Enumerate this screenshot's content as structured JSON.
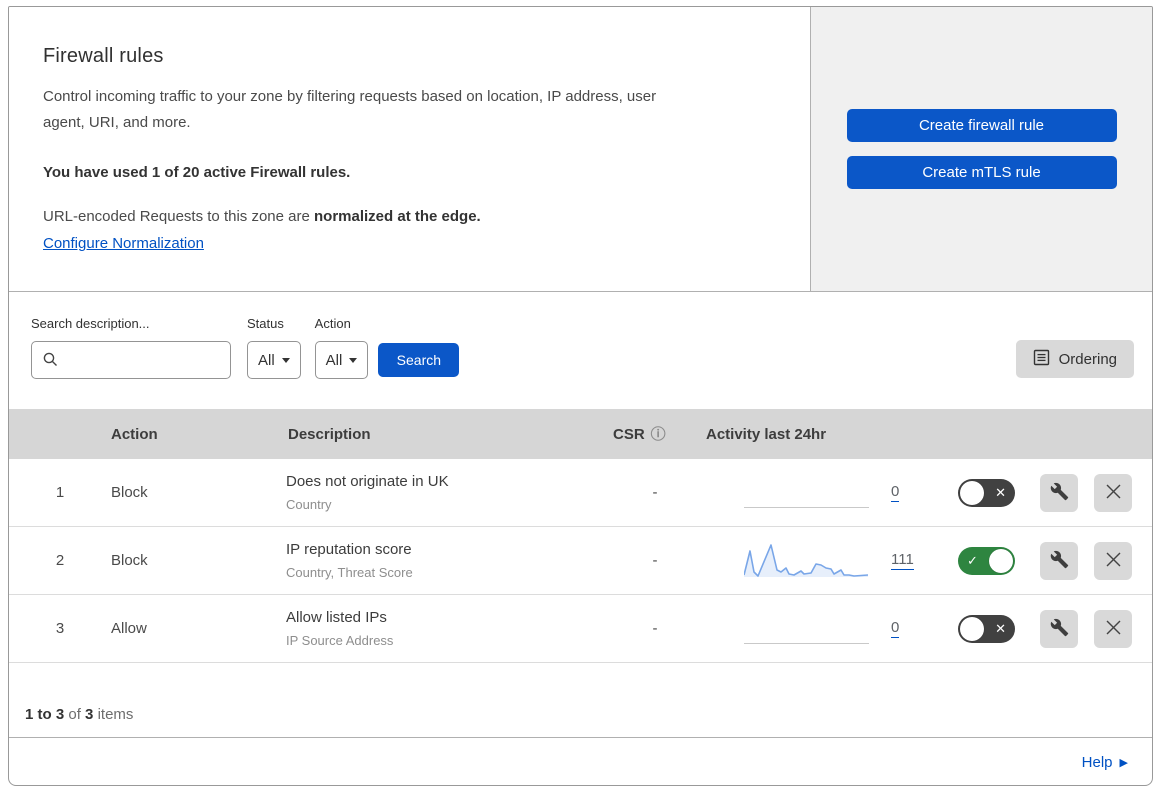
{
  "header": {
    "title": "Firewall rules",
    "description": "Control incoming traffic to your zone by filtering requests based on location, IP address, user agent, URI, and more.",
    "usage": "You have used 1 of 20 active Firewall rules.",
    "normalization_text": "URL-encoded Requests to this zone are ",
    "normalization_bold": "normalized at the edge.",
    "normalization_link": "Configure Normalization",
    "create_firewall_button": "Create firewall rule",
    "create_mtls_button": "Create mTLS rule"
  },
  "filters": {
    "search_label": "Search description...",
    "search_value": "",
    "status_label": "Status",
    "status_value": "All",
    "action_label": "Action",
    "action_value": "All",
    "search_button": "Search",
    "ordering_button": "Ordering"
  },
  "table": {
    "columns": {
      "action": "Action",
      "description": "Description",
      "csr": "CSR",
      "activity": "Activity last 24hr"
    },
    "rows": [
      {
        "index": "1",
        "action": "Block",
        "title": "Does not originate in UK",
        "subtitle": "Country",
        "csr": "-",
        "count": "0",
        "enabled": false
      },
      {
        "index": "2",
        "action": "Block",
        "title": "IP reputation score",
        "subtitle": "Country, Threat Score",
        "csr": "-",
        "count": "111",
        "enabled": true
      },
      {
        "index": "3",
        "action": "Allow",
        "title": "Allow listed IPs",
        "subtitle": "IP Source Address",
        "csr": "-",
        "count": "0",
        "enabled": false
      }
    ],
    "chart_data": {
      "type": "area",
      "title": "Activity last 24hr sparkline (rule 2)",
      "total": 111,
      "points": [
        [
          0,
          32
        ],
        [
          6,
          8
        ],
        [
          10,
          29
        ],
        [
          14,
          33
        ],
        [
          27,
          2
        ],
        [
          33,
          27
        ],
        [
          37,
          29
        ],
        [
          42,
          25
        ],
        [
          45,
          31
        ],
        [
          50,
          32
        ],
        [
          57,
          28
        ],
        [
          60,
          31
        ],
        [
          67,
          30
        ],
        [
          72,
          21
        ],
        [
          77,
          22
        ],
        [
          82,
          25
        ],
        [
          87,
          26
        ],
        [
          90,
          31
        ],
        [
          97,
          27
        ],
        [
          100,
          32
        ],
        [
          105,
          32
        ],
        [
          110,
          33
        ],
        [
          124,
          32
        ]
      ]
    }
  },
  "footer": {
    "range": "1 to 3",
    "of_word": "of",
    "total": "3",
    "items_word": "items",
    "help_label": "Help"
  },
  "colors": {
    "accent_blue": "#0b57c8",
    "link_blue": "#0051c3",
    "toggle_on_green": "#2e8540",
    "toggle_off_dark": "#414141",
    "sparkline_blue": "#79a6e8",
    "panel_gray": "#f0f0f0",
    "header_row_gray": "#d6d6d6"
  }
}
